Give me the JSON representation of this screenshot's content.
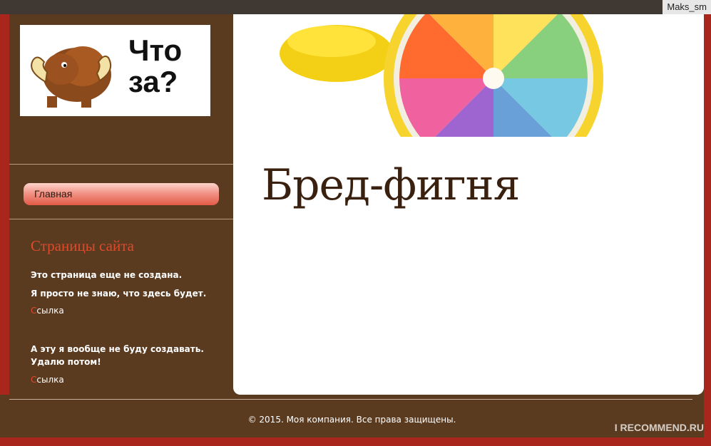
{
  "top_bar": {
    "username": "Maks_sm"
  },
  "sidebar": {
    "logo": {
      "text_line1": "Что",
      "text_line2": "за?",
      "icon": "mammoth-logo"
    },
    "menu": [
      {
        "label": "Главная"
      }
    ],
    "section_title": "Страницы сайта",
    "blocks": [
      {
        "lines": [
          "Это страница еще не создана.",
          "Я просто не знаю, что здесь будет."
        ],
        "link": "Ссылка"
      },
      {
        "lines": [
          "А эту я вообще не буду создавать. Удалю потом!"
        ],
        "link": "Ссылка"
      }
    ]
  },
  "content": {
    "hero_image": "rainbow-lemon-image",
    "heading": "Бред-фигня"
  },
  "footer": {
    "copyright": "© 2015. Моя компания. Все права защищены."
  },
  "watermark": "I RECOMMEND.RU",
  "colors": {
    "brand": "#5a3b20",
    "accent": "#e04a2b",
    "border": "#a8261b"
  }
}
